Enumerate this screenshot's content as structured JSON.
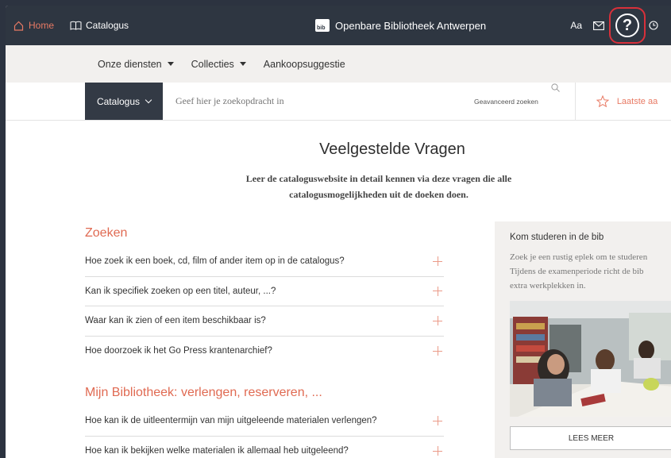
{
  "topbar": {
    "home_label": "Home",
    "catalogus_label": "Catalogus",
    "site_title": "Openbare Bibliotheek Antwerpen",
    "logo_text": "bib",
    "font_size_label": "Aa",
    "help_label": "?"
  },
  "nav": {
    "items": [
      {
        "label": "Onze diensten"
      },
      {
        "label": "Collecties"
      },
      {
        "label": "Aankoopsuggestie"
      }
    ]
  },
  "search": {
    "scope_label": "Catalogus",
    "placeholder": "Geef hier je zoekopdracht in",
    "advanced_label": "Geavanceerd zoeken",
    "recent_label": "Laatste aa"
  },
  "page": {
    "title": "Veelgestelde Vragen",
    "subtitle_line1": "Leer de catalogus­website in detail kennen via deze vragen die alle",
    "subtitle_line2": "catalogusmogelijkheden uit de doeken doen."
  },
  "sections": [
    {
      "heading": "Zoeken",
      "questions": [
        "Hoe zoek ik een boek, cd, film of ander item op in de catalogus?",
        "Kan ik specifiek zoeken op een titel, auteur, ...?",
        "Waar kan ik zien of een item beschikbaar is?",
        "Hoe doorzoek ik het Go Press krantenarchief?"
      ]
    },
    {
      "heading": "Mijn Bibliotheek: verlengen, reserveren, ...",
      "questions": [
        "Hoe kan ik de uitleentermijn van mijn uitgeleende materialen verlengen?",
        "Hoe kan ik bekijken welke materialen ik allemaal heb uitgeleend?"
      ]
    }
  ],
  "sidebar": {
    "title": "Kom studeren in de bib",
    "text_lines": [
      "Zoek je een rustig eplek om te studeren",
      "Tijdens de examenperiode richt de bib",
      "extra werkplekken in."
    ],
    "button_label": "LEES MEER"
  },
  "colors": {
    "topbar": "#2e3641",
    "accent": "#e87a64",
    "help_highlight": "#d9303a"
  }
}
